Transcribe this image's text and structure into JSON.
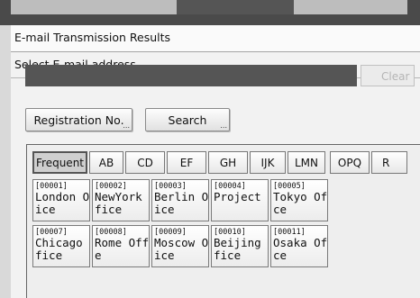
{
  "window": {
    "title": "E-mail Transmission Results",
    "subtitle": "Select E-mail address."
  },
  "entry": {
    "value": "",
    "clear_label": "Clear"
  },
  "options": {
    "registration_label": "Registration No.",
    "search_label": "Search",
    "more_marker": "..."
  },
  "tabs": [
    {
      "label": "Frequent",
      "active": true
    },
    {
      "label": "AB"
    },
    {
      "label": "CD"
    },
    {
      "label": "EF"
    },
    {
      "label": "GH"
    },
    {
      "label": "IJK"
    },
    {
      "label": "LMN"
    },
    {
      "label": "OPQ"
    },
    {
      "label": "R"
    }
  ],
  "destinations": [
    {
      "number": "[00001]",
      "name": "London Off\nice"
    },
    {
      "number": "[00002]",
      "name": "NewYork Of\nfice"
    },
    {
      "number": "[00003]",
      "name": "Berlin Off\nice"
    },
    {
      "number": "[00004]",
      "name": "Project"
    },
    {
      "number": "[00005]",
      "name": "Tokyo Of\nce"
    },
    {
      "number": "[00007]",
      "name": "Chicago Of\nfice"
    },
    {
      "number": "[00008]",
      "name": "Rome Offic\ne"
    },
    {
      "number": "[00009]",
      "name": "Moscow Off\nice"
    },
    {
      "number": "[00010]",
      "name": "Beijing Of\nfice"
    },
    {
      "number": "[00011]",
      "name": "Osaka Of\nce"
    }
  ]
}
